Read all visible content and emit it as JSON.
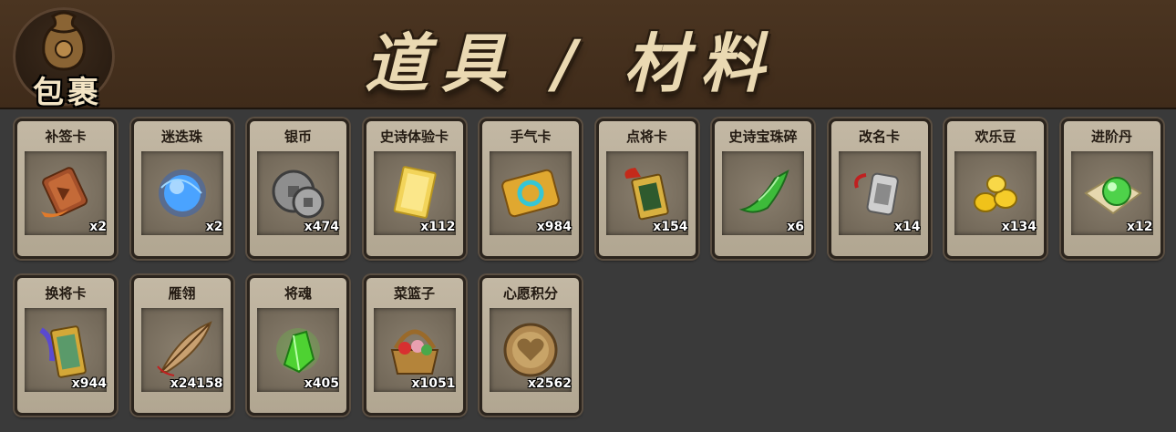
{
  "header": {
    "bag_label": "包裹",
    "title": "道具 / 材料"
  },
  "colors": {
    "header_bg": "#45301d",
    "page_bg": "#3a3a3a",
    "card_bg": "#b9ae99",
    "title_text": "#ead9b2"
  },
  "items": [
    {
      "name": "补签卡",
      "count": "x2",
      "icon": "resign-card-icon"
    },
    {
      "name": "迷迭珠",
      "count": "x2",
      "icon": "blue-orb-icon"
    },
    {
      "name": "银币",
      "count": "x474",
      "icon": "silver-coin-icon"
    },
    {
      "name": "史诗体验卡",
      "count": "x112",
      "icon": "gold-card-icon"
    },
    {
      "name": "手气卡",
      "count": "x984",
      "icon": "luck-card-icon"
    },
    {
      "name": "点将卡",
      "count": "x154",
      "icon": "general-card-icon"
    },
    {
      "name": "史诗宝珠碎",
      "count": "x6",
      "icon": "jade-shard-icon"
    },
    {
      "name": "改名卡",
      "count": "x14",
      "icon": "rename-tag-icon"
    },
    {
      "name": "欢乐豆",
      "count": "x134",
      "icon": "gold-beans-icon"
    },
    {
      "name": "进阶丹",
      "count": "x12",
      "icon": "green-pill-icon"
    },
    {
      "name": "换将卡",
      "count": "x944",
      "icon": "swap-card-icon"
    },
    {
      "name": "雁翎",
      "count": "x24158",
      "icon": "feather-icon"
    },
    {
      "name": "将魂",
      "count": "x405",
      "icon": "green-crystal-icon"
    },
    {
      "name": "菜篮子",
      "count": "x1051",
      "icon": "basket-icon"
    },
    {
      "name": "心愿积分",
      "count": "x2562",
      "icon": "heart-coin-icon"
    }
  ]
}
